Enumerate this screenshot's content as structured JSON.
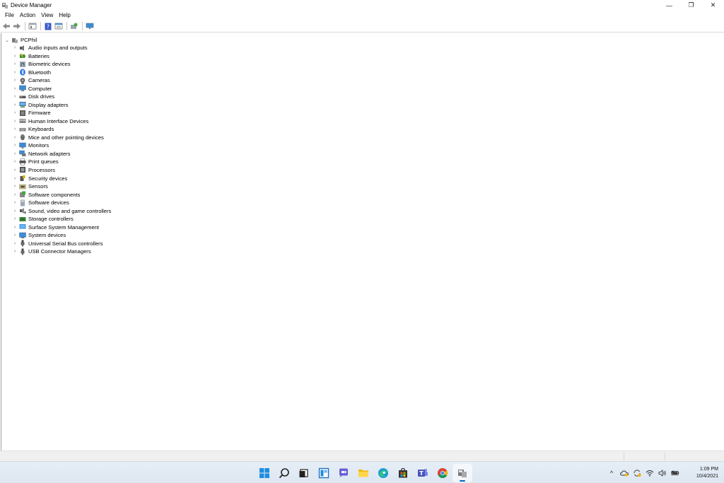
{
  "window": {
    "title": "Device Manager",
    "controls": {
      "minimize": "—",
      "restore": "❐",
      "close": "✕"
    }
  },
  "menu": [
    "File",
    "Action",
    "View",
    "Help"
  ],
  "toolbar_icons": [
    "back-arrow-icon",
    "forward-arrow-icon",
    "properties-icon",
    "help-icon",
    "view-icon",
    "scan-hardware-icon",
    "monitor-icon"
  ],
  "tree": {
    "root": {
      "label": "PCPhil",
      "expander": "⌄"
    },
    "collapsed_glyph": "›",
    "items": [
      {
        "label": "Audio inputs and outputs",
        "icon": "speaker-icon"
      },
      {
        "label": "Batteries",
        "icon": "battery-icon"
      },
      {
        "label": "Biometric devices",
        "icon": "fingerprint-icon"
      },
      {
        "label": "Bluetooth",
        "icon": "bluetooth-icon"
      },
      {
        "label": "Cameras",
        "icon": "camera-icon"
      },
      {
        "label": "Computer",
        "icon": "computer-icon"
      },
      {
        "label": "Disk drives",
        "icon": "disk-drive-icon"
      },
      {
        "label": "Display adapters",
        "icon": "display-adapter-icon"
      },
      {
        "label": "Firmware",
        "icon": "firmware-icon"
      },
      {
        "label": "Human Interface Devices",
        "icon": "hid-icon"
      },
      {
        "label": "Keyboards",
        "icon": "keyboard-icon"
      },
      {
        "label": "Mice and other pointing devices",
        "icon": "mouse-icon"
      },
      {
        "label": "Monitors",
        "icon": "monitor-icon"
      },
      {
        "label": "Network adapters",
        "icon": "network-adapter-icon"
      },
      {
        "label": "Print queues",
        "icon": "printer-icon"
      },
      {
        "label": "Processors",
        "icon": "processor-icon"
      },
      {
        "label": "Security devices",
        "icon": "security-device-icon"
      },
      {
        "label": "Sensors",
        "icon": "sensor-icon"
      },
      {
        "label": "Software components",
        "icon": "software-component-icon"
      },
      {
        "label": "Software devices",
        "icon": "software-device-icon"
      },
      {
        "label": "Sound, video and game controllers",
        "icon": "sound-controller-icon"
      },
      {
        "label": "Storage controllers",
        "icon": "storage-controller-icon"
      },
      {
        "label": "Surface System Management",
        "icon": "surface-management-icon"
      },
      {
        "label": "System devices",
        "icon": "system-device-icon"
      },
      {
        "label": "Universal Serial Bus controllers",
        "icon": "usb-icon"
      },
      {
        "label": "USB Connector Managers",
        "icon": "usb-connector-icon"
      }
    ]
  },
  "taskbar": {
    "apps": [
      "start-icon",
      "search-icon",
      "task-view-icon",
      "widgets-icon",
      "chat-icon",
      "file-explorer-icon",
      "edge-icon",
      "store-icon",
      "teams-icon",
      "chrome-icon",
      "device-manager-icon"
    ],
    "tray": {
      "chevron": "^",
      "time": "1:09 PM",
      "date": "10/4/2021"
    }
  }
}
